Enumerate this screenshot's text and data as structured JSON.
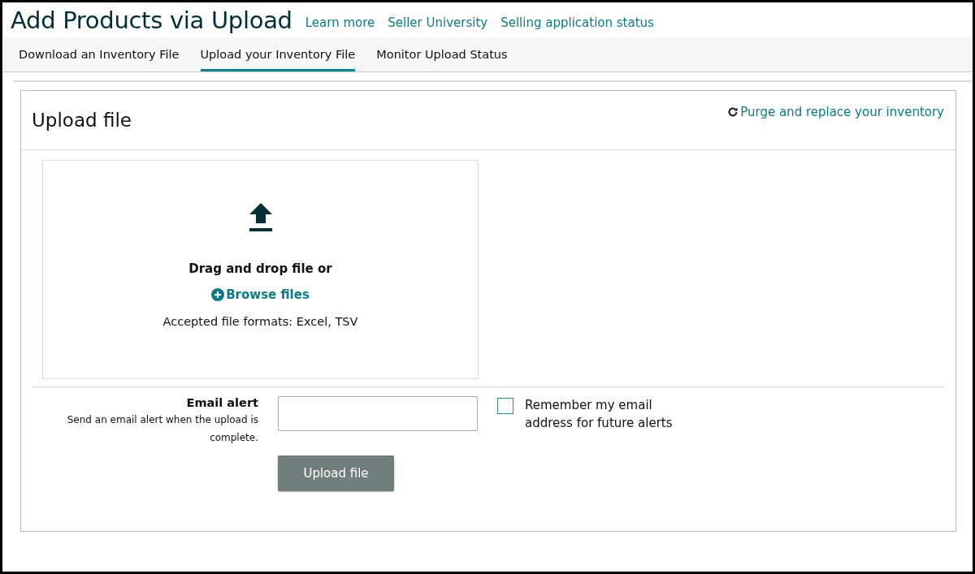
{
  "header": {
    "title": "Add Products via Upload",
    "links": [
      "Learn more",
      "Seller University",
      "Selling application status"
    ]
  },
  "tabs": [
    {
      "label": "Download an Inventory File",
      "selected": false
    },
    {
      "label": "Upload your Inventory File",
      "selected": true
    },
    {
      "label": "Monitor Upload Status",
      "selected": false
    }
  ],
  "card": {
    "title": "Upload file",
    "purge_link": "Purge and replace your inventory",
    "dropzone": {
      "prompt": "Drag and drop file or",
      "browse_link": "Browse files",
      "formats": "Accepted file formats: Excel, TSV"
    },
    "email_alert": {
      "label": "Email alert",
      "help": "Send an email alert when the upload is complete.",
      "remember": {
        "label": "Remember my email address for future alerts",
        "checked": false
      }
    },
    "upload_button": {
      "label": "Upload file",
      "disabled": true
    }
  }
}
